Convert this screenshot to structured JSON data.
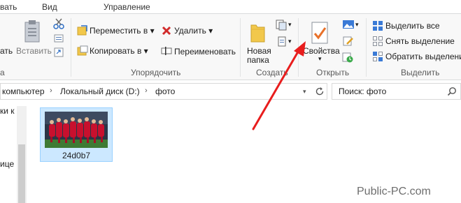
{
  "tabs": {
    "share": "вать",
    "view": "Вид",
    "manage": "Управление"
  },
  "ribbon": {
    "clipboard": {
      "paste_left": "ать",
      "paste": "Вставить",
      "group_tail": "а"
    },
    "organize": {
      "move_to": "Переместить в",
      "copy_to": "Копировать в",
      "delete": "Удалить",
      "rename": "Переименовать",
      "group": "Упорядочить"
    },
    "create": {
      "new_folder_line1": "Новая",
      "new_folder_line2": "папка",
      "group": "Создать"
    },
    "open": {
      "properties": "Свойства",
      "group": "Открыть"
    },
    "select": {
      "select_all": "Выделить все",
      "select_none": "Снять выделение",
      "invert": "Обратить выделени",
      "group": "Выделить"
    }
  },
  "address": {
    "crumbs": [
      "компьютер",
      "Локальный диск (D:)",
      "фото"
    ]
  },
  "search": {
    "placeholder": "Поиск: фото"
  },
  "navpane": {
    "item1": "ки к в",
    "item2": "ице"
  },
  "files": [
    {
      "name": "24d0b7"
    }
  ],
  "watermark": "Public-PC.com",
  "colors": {
    "arrow": "#e81d1d",
    "selection": "#cce8ff",
    "selection_border": "#99d1ff"
  }
}
